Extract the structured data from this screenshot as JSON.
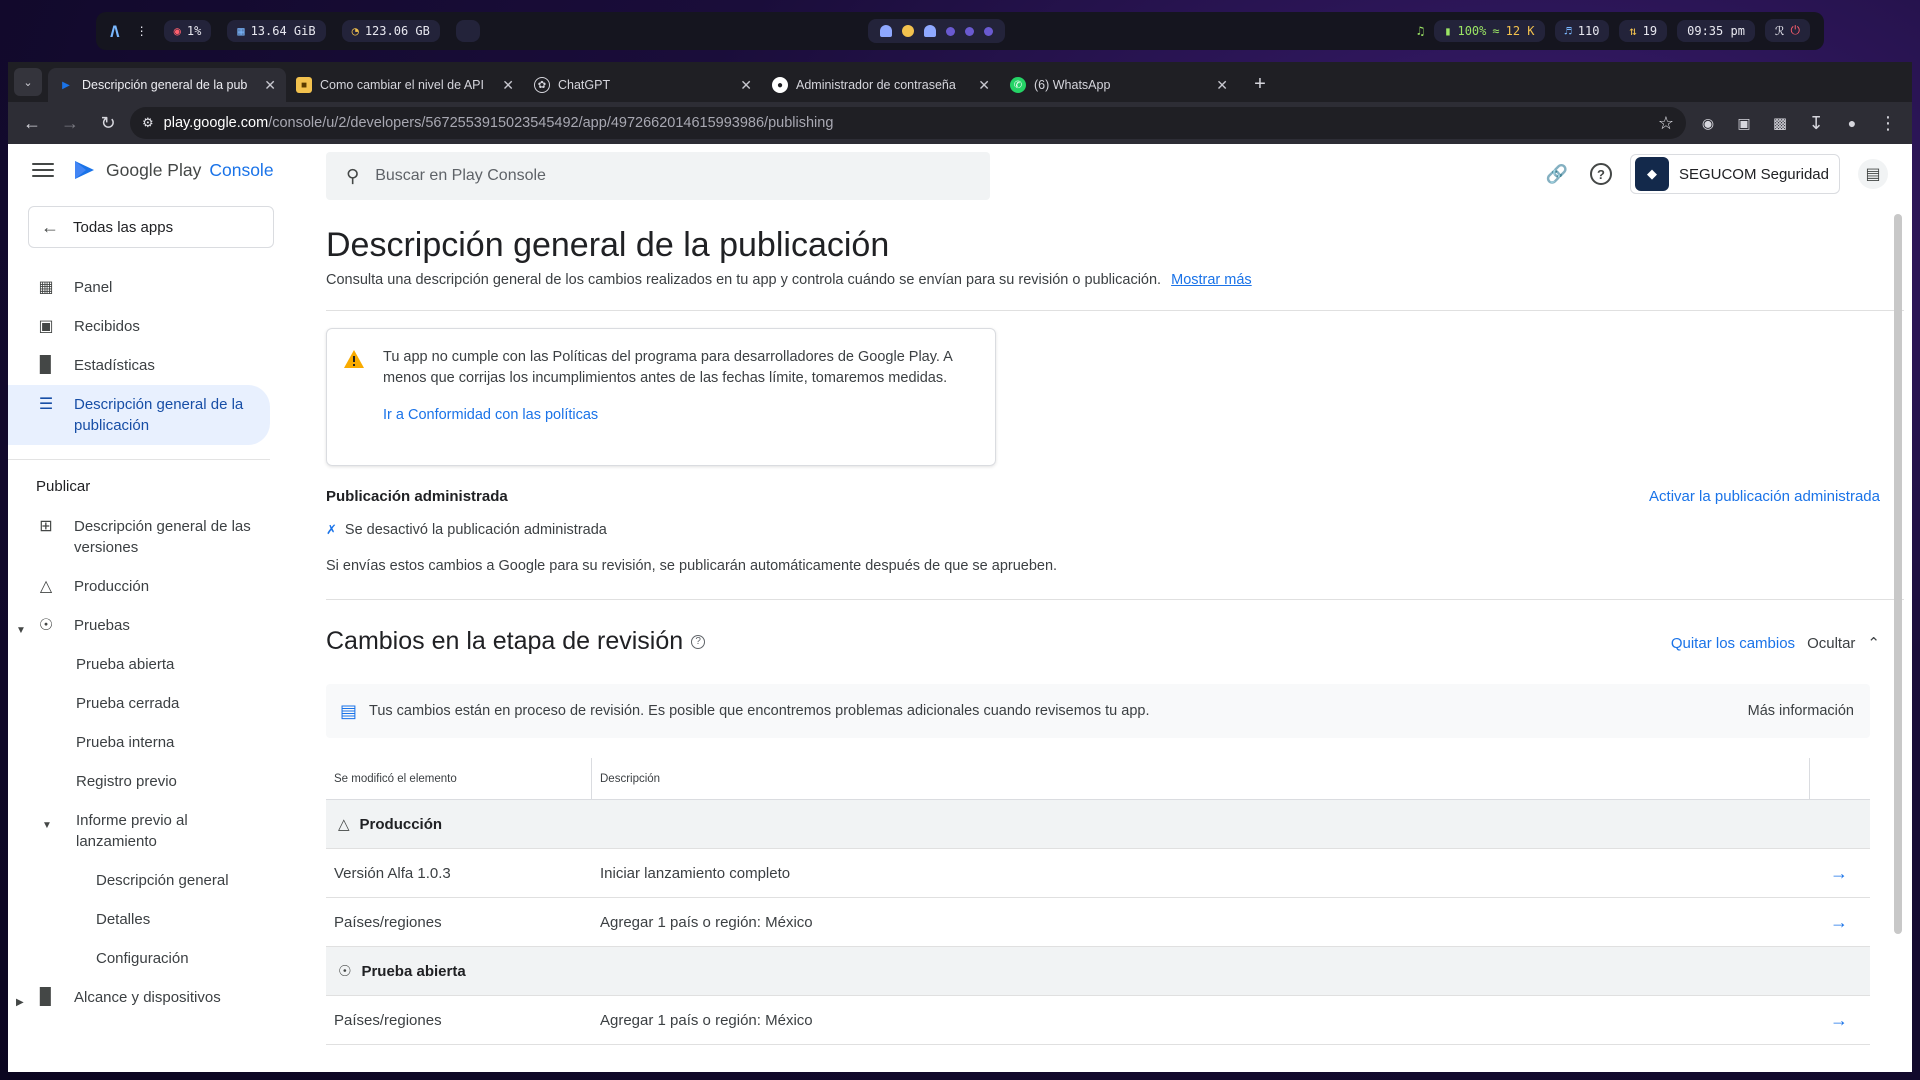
{
  "system_bar": {
    "cpu": "1%",
    "memory": "13.64 GiB",
    "disk": "123.06 GB",
    "battery": "100%",
    "network": "12 K",
    "volume": "110",
    "updates": "19",
    "clock": "09:35 pm"
  },
  "tabs": [
    {
      "title": "Descripción general de la pub",
      "favicon": "play-console-icon",
      "active": true
    },
    {
      "title": "Como cambiar el nivel de API",
      "favicon": "doc-icon",
      "active": false
    },
    {
      "title": "ChatGPT",
      "favicon": "chatgpt-icon",
      "active": false
    },
    {
      "title": "Administrador de contraseña",
      "favicon": "password-icon",
      "active": false
    },
    {
      "title": "(6) WhatsApp",
      "favicon": "whatsapp-icon",
      "active": false
    }
  ],
  "toolbar": {
    "url_host": "play.google.com",
    "url_path": "/console/u/2/developers/5672553915023545492/app/4972662014615993986/publishing"
  },
  "brand": {
    "google_play": "Google Play",
    "console": "Console"
  },
  "sidebar": {
    "all_apps": "Todas las apps",
    "items": [
      {
        "label": "Panel"
      },
      {
        "label": "Recibidos"
      },
      {
        "label": "Estadísticas"
      },
      {
        "label": "Descripción general de la publicación"
      }
    ],
    "section_publicar": "Publicar",
    "publish_items": [
      {
        "label": "Descripción general de las versiones"
      },
      {
        "label": "Producción"
      },
      {
        "label": "Pruebas"
      },
      {
        "label": "Prueba abierta"
      },
      {
        "label": "Prueba cerrada"
      },
      {
        "label": "Prueba interna"
      },
      {
        "label": "Registro previo"
      },
      {
        "label": "Informe previo al lanzamiento"
      },
      {
        "label": "Descripción general"
      },
      {
        "label": "Detalles"
      },
      {
        "label": "Configuración"
      },
      {
        "label": "Alcance y dispositivos"
      }
    ]
  },
  "search": {
    "placeholder": "Buscar en Play Console"
  },
  "account": {
    "name": "SEGUCOM Seguridad"
  },
  "main": {
    "title": "Descripción general de la publicación",
    "subtitle": "Consulta una descripción general de los cambios realizados en tu app y controla cuándo se envían para su revisión o publicación.",
    "show_more": "Mostrar más",
    "warning": {
      "text": "Tu app no cumple con las Políticas del programa para desarrolladores de Google Play. A menos que corrijas los incumplimientos antes de las fechas límite, tomaremos medidas.",
      "link": "Ir a Conformidad con las políticas"
    },
    "managed_publishing": {
      "title": "Publicación administrada",
      "action": "Activar la publicación administrada",
      "status": "Se desactivó la publicación administrada",
      "note": "Si envías estos cambios a Google para su revisión, se publicarán automáticamente después de que se aprueben."
    },
    "review_section": {
      "title": "Cambios en la etapa de revisión",
      "remove_changes": "Quitar los cambios",
      "hide": "Ocultar",
      "info": "Tus cambios están en proceso de revisión. Es posible que encontremos problemas adicionales cuando revisemos tu app.",
      "more_info": "Más información"
    },
    "table": {
      "headers": [
        "Se modificó el elemento",
        "Descripción"
      ],
      "groups": [
        {
          "name": "Producción",
          "rows": [
            {
              "item": "Versión Alfa 1.0.3",
              "description": "Iniciar lanzamiento completo"
            },
            {
              "item": "Países/regiones",
              "description": "Agregar 1 país o región: México"
            }
          ]
        },
        {
          "name": "Prueba abierta",
          "rows": [
            {
              "item": "Países/regiones",
              "description": "Agregar 1 país o región: México"
            }
          ]
        }
      ]
    }
  },
  "colors": {
    "accent": "#1a73e8",
    "active_nav_bg": "#e8f0fe",
    "warning": "#f9ab00"
  }
}
